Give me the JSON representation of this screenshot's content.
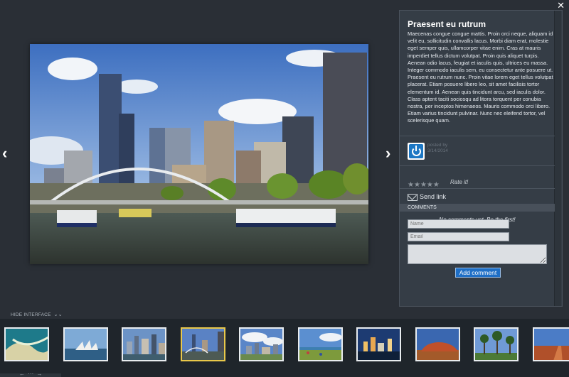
{
  "viewer": {
    "close_icon": "close-icon",
    "prev_label": "‹",
    "next_label": "›"
  },
  "photo": {
    "subject": "city-skyline-river-photo"
  },
  "sidebar": {
    "title": "Praesent eu rutrum",
    "description": " Maecenas congue congue mattis. Proin orci neque, aliquam id velit eu, sollicitudin convallis lacus. Morbi diam erat, molestie eget semper quis, ullamcorper vitae enim. Cras at mauris imperdiet tellus dictum volutpat. Proin quis aliquet turpis. Aenean odio lacus, feugiat et iaculis quis, ultrices eu massa. Integer commodo iaculis sem, eu consectetur ante posuere ut. Praesent eu rutrum nunc. Proin vitae lorem eget tellus volutpat placerat. Etiam posuere libero leo, sit amet facilisis tortor elementum id. Aenean quis tincidunt arcu, sed iaculis dolor. Class aptent taciti sociosqu ad litora torquent per conubia nostra, per inceptos himenaeos. Mauris commodo orci libero. Etiam varius tincidunt pulvinar. Nunc nec eleifend tortor, vel scelerisque quam.",
    "posted_by": "posted by",
    "posted_date": "3/14/2014",
    "rating_max": 5,
    "rate_label": "Rate it!",
    "send_link_label": "Send link",
    "comments_header": "COMMENTS",
    "no_comments": "No comments yet. Be the first!",
    "name_placeholder": "Name",
    "email_placeholder": "Email",
    "add_comment_label": "Add comment"
  },
  "interface": {
    "hide_label": "HIDE INTERFACE",
    "hide_icon": "double-chevron-down-icon"
  },
  "thumbnails": [
    {
      "name": "thumb-coast-aerial",
      "active": false
    },
    {
      "name": "thumb-opera-house",
      "active": false
    },
    {
      "name": "thumb-city-harbour",
      "active": false
    },
    {
      "name": "thumb-city-bridge",
      "active": true
    },
    {
      "name": "thumb-city-clouds",
      "active": false
    },
    {
      "name": "thumb-beach-lawn",
      "active": false
    },
    {
      "name": "thumb-city-night",
      "active": false
    },
    {
      "name": "thumb-uluru",
      "active": false
    },
    {
      "name": "thumb-palm-trees",
      "active": false
    },
    {
      "name": "thumb-outback-road",
      "active": false
    }
  ],
  "bottom_nav": "← ⋯ →",
  "colors": {
    "background": "#2a2f36",
    "panel": "#353d46",
    "accent_button": "#1f6fc6",
    "active_thumb_border": "#e9c84a"
  }
}
